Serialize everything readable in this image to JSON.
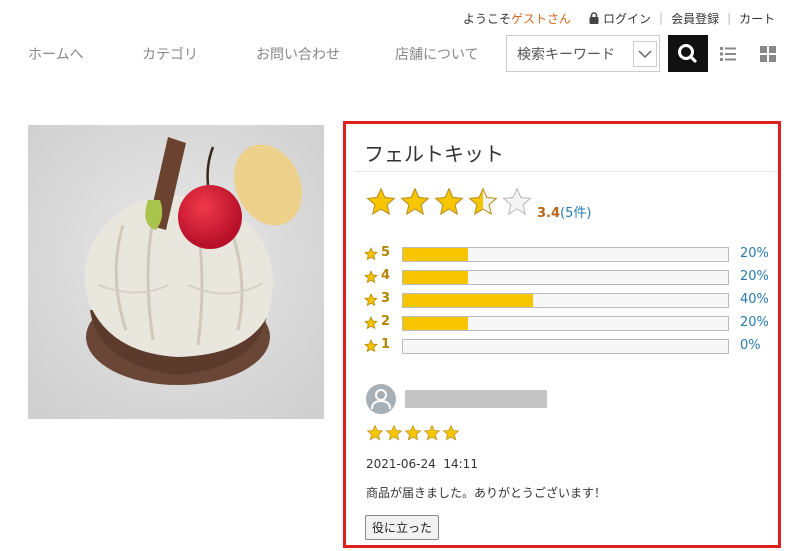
{
  "header": {
    "welcome_prefix": "ようこそ",
    "guest_name": "ゲストさん",
    "login_label": "ログイン",
    "register_label": "会員登録",
    "cart_label": "カート",
    "accent_color": "#d2691e"
  },
  "nav": {
    "items": [
      "ホームへ",
      "カテゴリ",
      "お問い合わせ",
      "店舗について"
    ]
  },
  "search": {
    "placeholder": "検索キーワード",
    "icons": [
      "chevron-down-icon",
      "search-icon",
      "list-view-icon",
      "grid-view-icon"
    ]
  },
  "product": {
    "title": "フェルトキット",
    "image_alt_icon": "felt-cake-image"
  },
  "rating": {
    "average": "3.4",
    "count_text": "(5件)",
    "average_value": 3.4,
    "distribution": [
      {
        "stars": "5",
        "fraction": 0.2,
        "percent": "20%"
      },
      {
        "stars": "4",
        "fraction": 0.2,
        "percent": "20%"
      },
      {
        "stars": "3",
        "fraction": 0.4,
        "percent": "40%"
      },
      {
        "stars": "2",
        "fraction": 0.2,
        "percent": "20%"
      },
      {
        "stars": "1",
        "fraction": 0.0,
        "percent": "0%"
      }
    ],
    "star_color": "#f7c600",
    "link_color": "#2a7ab0"
  },
  "review": {
    "stars": 5,
    "date": "2021-06-24  14:11",
    "text": "商品が届きました。ありがとうございます！",
    "helpful_label": "役に立った"
  },
  "panel_border_color": "#e0201f"
}
